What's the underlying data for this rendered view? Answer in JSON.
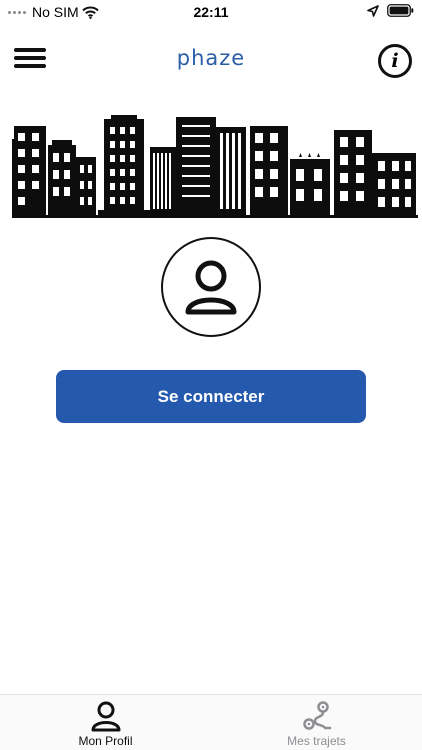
{
  "status_bar": {
    "carrier": "No SIM",
    "time": "22:11",
    "icons": [
      "signal-dots-icon",
      "wifi-icon",
      "location-arrow-icon",
      "battery-icon"
    ]
  },
  "header": {
    "brand": "phaze",
    "menu_icon": "hamburger-menu-icon",
    "info_icon": "info-icon",
    "info_glyph": "i",
    "accent_color": "#2a5fa8"
  },
  "hero": {
    "illustration": "city-skyline-icon"
  },
  "profile": {
    "avatar_icon": "user-icon"
  },
  "login": {
    "button_label": "Se connecter",
    "button_color": "#2459ae"
  },
  "tab_bar": {
    "tabs": [
      {
        "label": "Mon Profil",
        "icon": "user-icon",
        "active": true
      },
      {
        "label": "Mes trajets",
        "icon": "route-icon",
        "active": false
      }
    ]
  }
}
